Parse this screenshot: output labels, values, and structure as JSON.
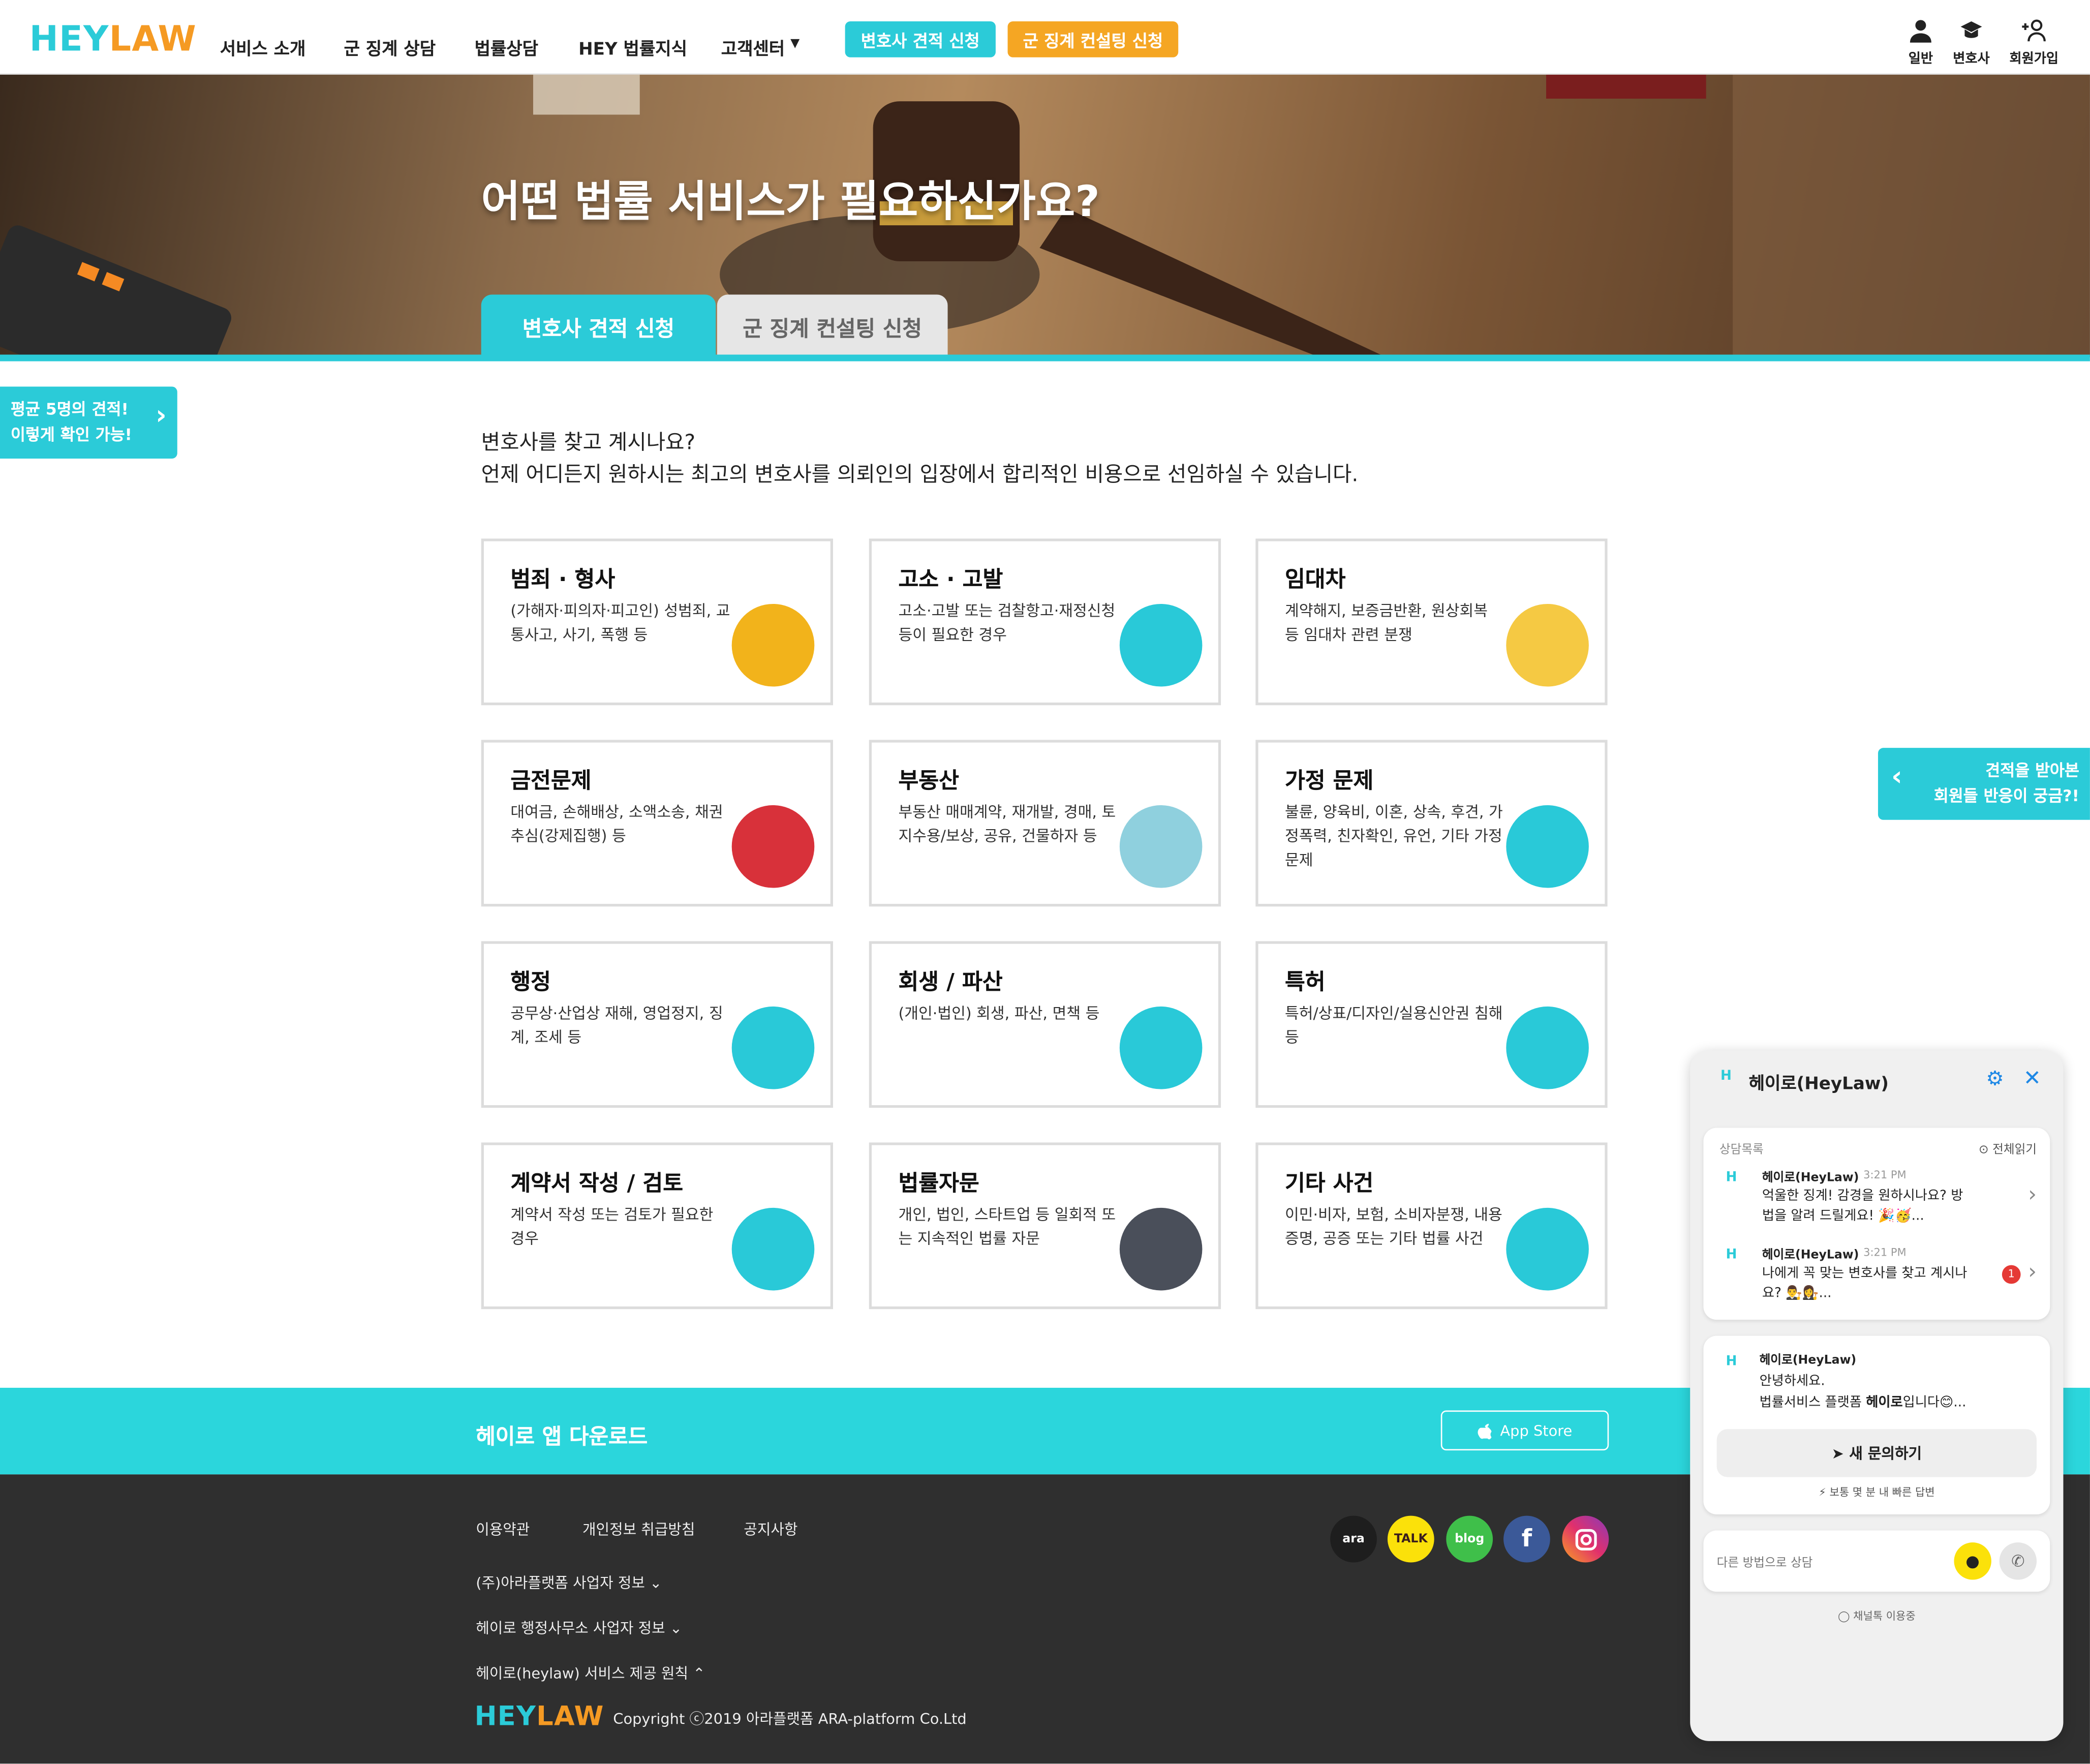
{
  "header": {
    "logo_a": "HEY",
    "logo_b": "LAW",
    "nav": [
      "서비스 소개",
      "군 징계 상담",
      "법률상담",
      "HEY 법률지식",
      "고객센터"
    ],
    "btn_lawyer": "변호사 견적 신청",
    "btn_military": "군 징계 컨설팅 신청",
    "user_general": "일반",
    "user_lawyer": "변호사",
    "user_signup": "회원가입"
  },
  "hero": {
    "title": "어떤 법률 서비스가 필요하신가요?",
    "tab_active": "변호사 견적 신청",
    "tab_inactive": "군 징계 컨설팅 신청"
  },
  "side_left": {
    "line1": "평균 5명의 견적!",
    "line2": "이렇게 확인 가능!"
  },
  "side_right": {
    "line1": "견적을 받아본",
    "line2": "회원들 반응이 궁금?!"
  },
  "intro": {
    "line1": "변호사를 찾고 계시나요?",
    "line2": "언제 어디든지 원하시는 최고의 변호사를 의뢰인의 입장에서 합리적인 비용으로 선임하실 수 있습니다."
  },
  "cards": [
    {
      "title": "범죄 · 형사",
      "desc": "(가해자·피의자·피고인) 성범죄, 교통사고, 사기, 폭행 등",
      "icon": "handcuffs-icon",
      "color": "#f2b31b"
    },
    {
      "title": "고소 · 고발",
      "desc": "고소·고발 또는 검찰항고·재정신청 등이 필요한 경우",
      "icon": "gavel-icon",
      "color": "#29c9d8"
    },
    {
      "title": "임대차",
      "desc": "계약해지, 보증금반환, 원상회복 등 임대차 관련 분쟁",
      "icon": "building-icon",
      "color": "#f5c943"
    },
    {
      "title": "금전문제",
      "desc": "대여금, 손해배상, 소액소송, 채권추심(강제집행) 등",
      "icon": "money-icon",
      "color": "#d8313a"
    },
    {
      "title": "부동산",
      "desc": "부동산 매매계약, 재개발, 경매, 토지수용/보상, 공유, 건물하자 등",
      "icon": "tower-icon",
      "color": "#8fd0de"
    },
    {
      "title": "가정 문제",
      "desc": "불륜, 양육비, 이혼, 상속, 후견, 가정폭력, 친자확인, 유언, 기타 가정 문제",
      "icon": "family-icon",
      "color": "#29c9d8"
    },
    {
      "title": "행정",
      "desc": "공무상·산업상 재해, 영업정지, 징계, 조세 등",
      "icon": "money-bag-icon",
      "color": "#29c9d8"
    },
    {
      "title": "회생 / 파산",
      "desc": "(개인·법인) 회생, 파산, 면책 등",
      "icon": "scissors-money-icon",
      "color": "#29c9d8"
    },
    {
      "title": "특허",
      "desc": "특허/상표/디자인/실용신안권 침해 등",
      "icon": "certificate-icon",
      "color": "#29c9d8"
    },
    {
      "title": "계약서 작성 / 검토",
      "desc": "계약서 작성 또는 검토가 필요한 경우",
      "icon": "document-pen-icon",
      "color": "#29c9d8"
    },
    {
      "title": "법률자문",
      "desc": "개인, 법인, 스타트업 등 일회적 또는 지속적인 법률 자문",
      "icon": "handshake-icon",
      "color": "#4a4f5a"
    },
    {
      "title": "기타 사건",
      "desc": "이민·비자, 보험, 소비자분쟁, 내용증명, 공증 또는 기타 법률 사건",
      "icon": "inbox-icon",
      "color": "#29c9d8"
    }
  ],
  "download": {
    "title": "헤이로 앱 다운로드",
    "appstore": "App Store"
  },
  "footer": {
    "links": [
      "이용약관",
      "개인정보 취급방침",
      "공지사항"
    ],
    "biz1": "(주)아라플랫폼 사업자 정보",
    "biz2": "헤이로 행정사무소 사업자 정보",
    "biz3": "헤이로(heylaw) 서비스 제공 원칙",
    "copyright": "Copyright ⓒ2019 아라플랫폼 ARA-platform Co.Ltd",
    "social": [
      "ara",
      "TALK",
      "blog",
      "f",
      "instagram"
    ]
  },
  "chat": {
    "title": "헤이로(HeyLaw)",
    "list_label": "상담목록",
    "read_all": "전체읽기",
    "msgs": [
      {
        "name": "헤이로(HeyLaw)",
        "time": "3:21 PM",
        "text": "억울한 징계! 감경을 원하시나요? 방법을 알려 드릴게요! 🎉🥳..."
      },
      {
        "name": "헤이로(HeyLaw)",
        "time": "3:21 PM",
        "text": "나에게 꼭 맞는 변호사를 찾고 계시나요? 👨‍⚖️👩‍⚖️...",
        "badge": "1"
      }
    ],
    "greet_name": "헤이로(HeyLaw)",
    "greet_1": "안녕하세요.",
    "greet_2a": "법률서비스 플랫폼 ",
    "greet_2b": "헤이로",
    "greet_2c": "입니다😊...",
    "new_btn": "새 문의하기",
    "reply": "⚡ 보통 몇 분 내 빠른 답변",
    "other": "다른 방법으로 상담",
    "channel": "채널톡 이용중"
  }
}
